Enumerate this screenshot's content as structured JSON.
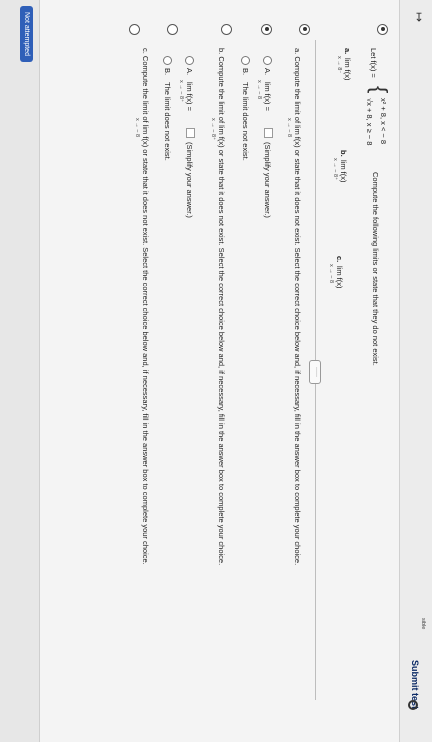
{
  "header": {
    "submit_label": "Submit test",
    "nav_fragment": "sible"
  },
  "question": {
    "let_prefix": "Let f(x) =",
    "piece1": "x² + 8,   x < − 8",
    "piece2": "√x + 8,   x ≥ − 8",
    "instruction": "Compute the following limits or state that they do not exist.",
    "part_a_label": "a.",
    "part_a_expr": "lim   f(x)",
    "part_a_sub": "x → 8⁻",
    "part_b_label": "b.",
    "part_b_expr": "lim   f(x)",
    "part_b_sub": "x → − 8⁺",
    "part_c_label": "c.",
    "part_c_expr": "lim   f(x)",
    "part_c_sub": "x → − 8",
    "dots_label": "·····"
  },
  "section_a": {
    "prompt": "a. Compute the limit of   lim   f(x) or state that it does not exist. Select the correct choice below and, if necessary, fill in the answer box to complete your choice.",
    "prompt_sub": "x → − 8",
    "choice_a_letter": "A.",
    "choice_a_text": "lim   f(x) =",
    "choice_a_sub": "x → − 8",
    "choice_a_hint": "(Simplify your answer.)",
    "choice_b_letter": "B.",
    "choice_b_text": "The limit does not exist."
  },
  "section_b": {
    "prompt": "b. Compute the limit of   lim   f(x) or state that it does not exist. Select the correct choice below and, if necessary, fill in the answer box to complete your choice.",
    "prompt_sub": "x → − 8⁺",
    "choice_a_letter": "A.",
    "choice_a_text": "lim   f(x) =",
    "choice_a_sub": "x → − 8⁺",
    "choice_a_hint": "(Simplify your answer.)",
    "choice_b_letter": "B.",
    "choice_b_text": "The limit does not exist."
  },
  "section_c": {
    "prompt": "c. Compute the limit of   lim   f(x) or state that it does not exist. Select the correct choice below and, if necessary, fill in the answer box to complete your choice.",
    "prompt_sub": "x → − 8"
  },
  "footer": {
    "status_label": "Not attempted"
  }
}
